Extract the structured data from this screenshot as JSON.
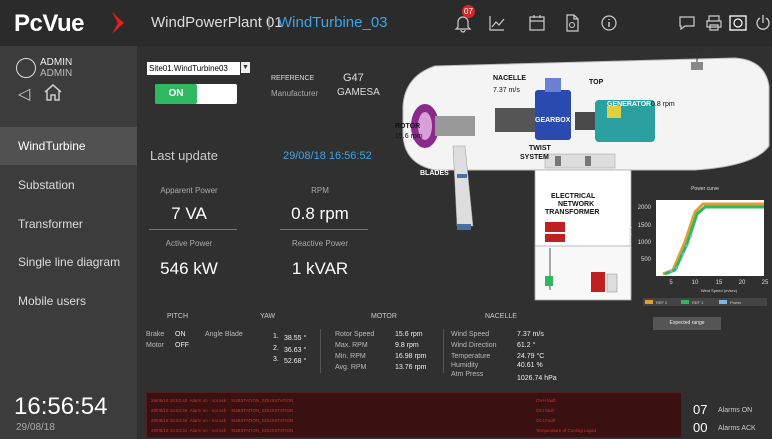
{
  "app": {
    "logo": "PcVue"
  },
  "header": {
    "title": "WindPowerPlant 01",
    "separator": "|",
    "subtitle": "WindTurbine_03",
    "alarm_badge": "07"
  },
  "user": {
    "name": "ADMIN",
    "role": "ADMIN"
  },
  "nav": {
    "items": [
      {
        "label": "WindTurbine",
        "active": true
      },
      {
        "label": "Substation",
        "active": false
      },
      {
        "label": "Transformer",
        "active": false
      },
      {
        "label": "Single line diagram",
        "active": false
      },
      {
        "label": "Mobile users",
        "active": false
      }
    ]
  },
  "clock": {
    "time": "16:56:54",
    "date": "29/08/18"
  },
  "asset": {
    "selected": "Site01.WindTurbine03",
    "toggle_on": "ON",
    "reference_label": "REFERENCE",
    "reference_value": "G47",
    "manufacturer_label": "Manufacturer",
    "manufacturer_value": "GAMESA"
  },
  "update": {
    "label": "Last update",
    "value": "29/08/18 16:56:52"
  },
  "measures": {
    "apparent_power_label": "Apparent Power",
    "apparent_power": "7 VA",
    "rpm_label": "RPM",
    "rpm": "0.8 rpm",
    "active_power_label": "Active Power",
    "active_power": "546 kW",
    "reactive_power_label": "Reactive Power",
    "reactive_power": "1 kVAR"
  },
  "turbine": {
    "nacelle_label": "NACELLE",
    "nacelle_speed": "7.37 m/s",
    "top_label": "TOP",
    "rotor_label": "ROTOR",
    "rotor_speed": "15.6 rpm",
    "gearbox_label": "GEARBOX",
    "generator_label": "GENERATOR",
    "generator_speed": "0.8 rpm",
    "twist_label": "TWIST",
    "system_label": "SYSTEM",
    "blades_label": "BLADES",
    "electrical_l1": "ELECTRICAL",
    "electrical_l2": "NETWORK",
    "electrical_l3": "TRANSFORMER"
  },
  "power_curve": {
    "title": "Power curve",
    "ylabel": "Power (kW)",
    "xlabel": "Wind Speed (m/sec)",
    "y_ticks": [
      "2000",
      "1500",
      "1000",
      "500"
    ],
    "x_ticks": [
      "5",
      "10",
      "15",
      "20",
      "25"
    ],
    "legend": [
      "REF 2",
      "REF 1",
      "Power"
    ],
    "legend_colors": [
      "#e0a030",
      "#2fb860",
      "#7ab8e8"
    ]
  },
  "sections": {
    "pitch": "PITCH",
    "yaw": "YAW",
    "motor": "MOTOR",
    "nacelle": "NACELLE"
  },
  "pitch": {
    "brake_label": "Brake",
    "brake_value": "ON",
    "motor_label": "Motor",
    "motor_value": "OFF"
  },
  "yaw": {
    "angle_label": "Angle Blade",
    "angles": [
      "1.",
      "38.55 °",
      "2.",
      "36.63 °",
      "3.",
      "52.68 °"
    ]
  },
  "motor": {
    "rows": [
      [
        "Rotor Speed",
        "15.6 rpm"
      ],
      [
        "Max. RPM",
        "9.8 rpm"
      ],
      [
        "Min. RPM",
        "16.98 rpm"
      ],
      [
        "Avg. RPM",
        "13.76 rpm"
      ]
    ]
  },
  "nacelle_data": {
    "rows": [
      [
        "Wind Speed",
        "7.37 m/s"
      ],
      [
        "Wind Direction",
        "61.2 °"
      ],
      [
        "Temperature",
        "24.79 °C"
      ],
      [
        "Humidity",
        "40.61 %"
      ],
      [
        "Atm Press",
        "1026.74 hPa"
      ]
    ]
  },
  "expected_range": "Expected range",
  "alarms": {
    "rows": [
      [
        "29/08/18 16:53:40",
        "Alarm on - not ack",
        "SUBSTATION_SOUSSTATION",
        "OVH fault"
      ],
      [
        "29/08/18 16:53:46",
        "Alarm on - not ack",
        "SUBSTATION_SOUSSTATION",
        "OCI fault"
      ],
      [
        "29/08/18 16:53:46",
        "Alarm on - not ack",
        "SUBSTATION_SOUSSTATION",
        "OCI Fault"
      ],
      [
        "29/08/18 16:53:34",
        "Alarm on - not ack",
        "SUBSTATION_SOUSSTATION",
        "Temperature of Cooling Liquid"
      ]
    ],
    "on_count": "07",
    "on_label": "Alarms ON",
    "ack_count": "00",
    "ack_label": "Alarms ACK"
  }
}
